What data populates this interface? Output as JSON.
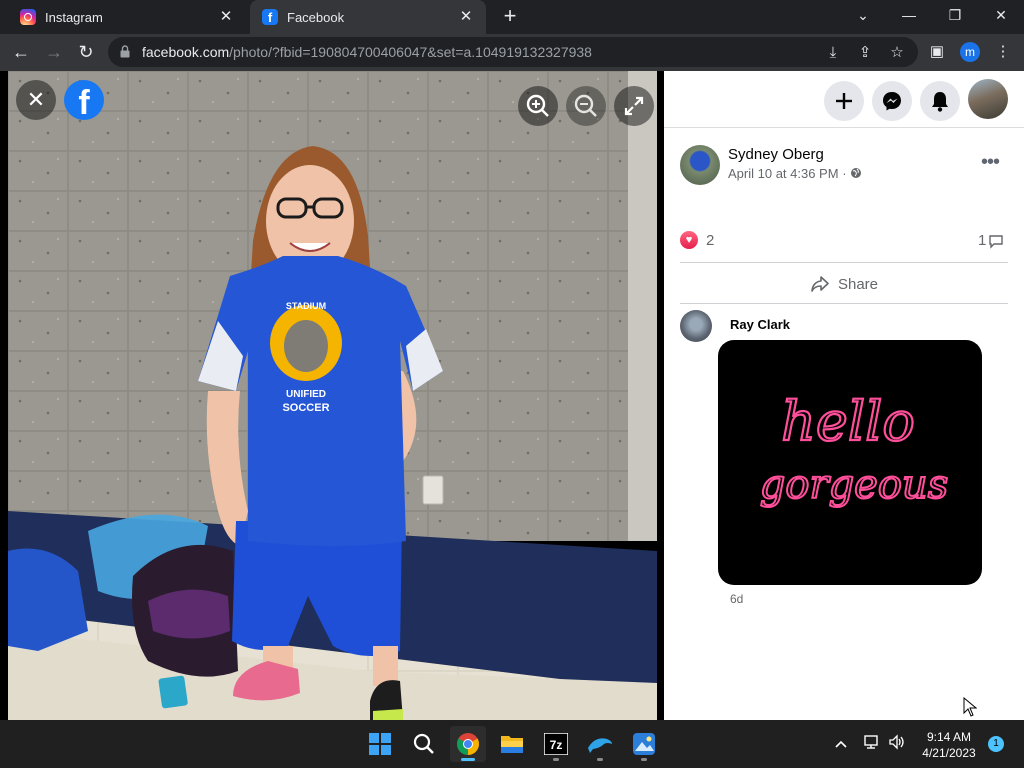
{
  "browser": {
    "tabs": [
      {
        "title": "Instagram",
        "icon": "instagram-icon"
      },
      {
        "title": "Facebook",
        "icon": "facebook-icon",
        "active": true
      }
    ],
    "url": {
      "host": "facebook.com",
      "path": "/photo/?fbid=190804700406047&set=a.104919132327938"
    },
    "profile_initial": "m"
  },
  "viewer": {
    "shirt_text_top": "STADIUM",
    "shirt_text_bottom_1": "UNIFIED",
    "shirt_text_bottom_2": "SOCCER"
  },
  "post": {
    "author": "Sydney Oberg",
    "timestamp": "April 10 at 4:36 PM",
    "separator": "·",
    "reaction_count": "2",
    "comment_count": "1",
    "share_label": "Share"
  },
  "comment": {
    "author": "Ray Clark",
    "gif_text_1": "hello",
    "gif_text_2": "gorgeous",
    "time": "6d"
  },
  "taskbar": {
    "time": "9:14 AM",
    "date": "4/21/2023",
    "notification_count": "1"
  },
  "colors": {
    "facebook_blue": "#1877f2",
    "reaction_red": "#e61e4d",
    "neon_pink": "#ff4f9a",
    "windows_accent": "#4cc2ff"
  }
}
